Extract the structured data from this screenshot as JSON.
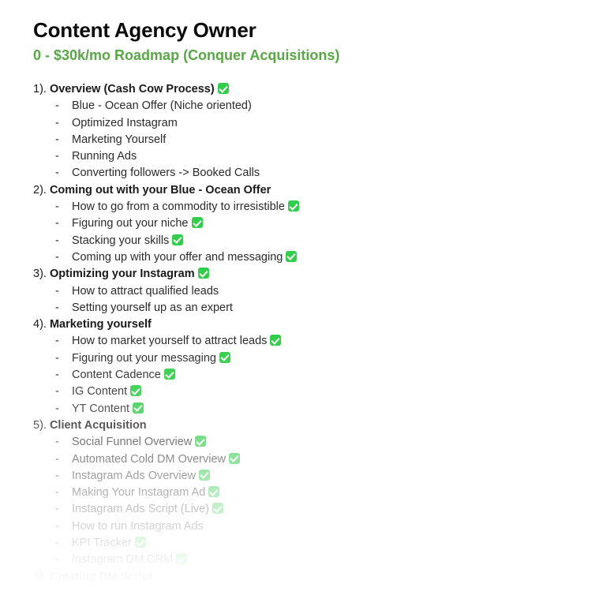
{
  "document": {
    "title": "Content Agency Owner",
    "subtitle": "0 - $30k/mo Roadmap (Conquer Acquisitions)",
    "accent_color": "#57a845",
    "check_color": "#32cd4b",
    "text_color": "#2b2b2b",
    "background_color": "#ffffff",
    "check_icon": "white-heavy-check-mark",
    "bullet_dash": "-",
    "sections": [
      {
        "number": "1).",
        "heading": "Overview (Cash Cow Process)",
        "heading_checked": true,
        "items": [
          {
            "text": "Blue - Ocean Offer (Niche oriented)",
            "checked": false
          },
          {
            "text": "Optimized Instagram",
            "checked": false
          },
          {
            "text": "Marketing Yourself",
            "checked": false
          },
          {
            "text": "Running Ads",
            "checked": false
          },
          {
            "text": "Converting followers -> Booked Calls",
            "checked": false
          }
        ]
      },
      {
        "number": "2).",
        "heading": "Coming out with your Blue - Ocean Offer",
        "heading_checked": false,
        "items": [
          {
            "text": "How to go from a commodity to irresistible",
            "checked": true
          },
          {
            "text": "Figuring out your niche",
            "checked": true
          },
          {
            "text": "Stacking your skills",
            "checked": true
          },
          {
            "text": "Coming up with your offer and messaging",
            "checked": true
          }
        ]
      },
      {
        "number": "3).",
        "heading": "Optimizing your Instagram",
        "heading_checked": true,
        "items": [
          {
            "text": "How to attract qualified leads",
            "checked": false
          },
          {
            "text": "Setting yourself up as an expert",
            "checked": false
          }
        ]
      },
      {
        "number": "4).",
        "heading": "Marketing yourself",
        "heading_checked": false,
        "items": [
          {
            "text": "How to market yourself to attract leads",
            "checked": true
          },
          {
            "text": "Figuring out your messaging",
            "checked": true
          },
          {
            "text": "Content Cadence",
            "checked": true
          },
          {
            "text": "IG Content",
            "checked": true
          },
          {
            "text": "YT Content",
            "checked": true
          }
        ]
      },
      {
        "number": "5).",
        "heading": "Client Acquisition",
        "heading_checked": false,
        "items": [
          {
            "text": "Social Funnel Overview",
            "checked": true
          },
          {
            "text": "Automated Cold DM Overview",
            "checked": true
          },
          {
            "text": "Instagram Ads Overview",
            "checked": true
          },
          {
            "text": "Making Your Instagram Ad",
            "checked": true
          },
          {
            "text": "Instagram Ads Script (Live)",
            "checked": true
          },
          {
            "text": "How to run Instagram Ads",
            "checked": false
          },
          {
            "text": "KPI Tracker",
            "checked": true
          },
          {
            "text": "Instagram DM CRM",
            "checked": true
          }
        ]
      },
      {
        "number": "6).",
        "heading": "Creating DM Script",
        "heading_checked": false,
        "items": []
      }
    ]
  }
}
